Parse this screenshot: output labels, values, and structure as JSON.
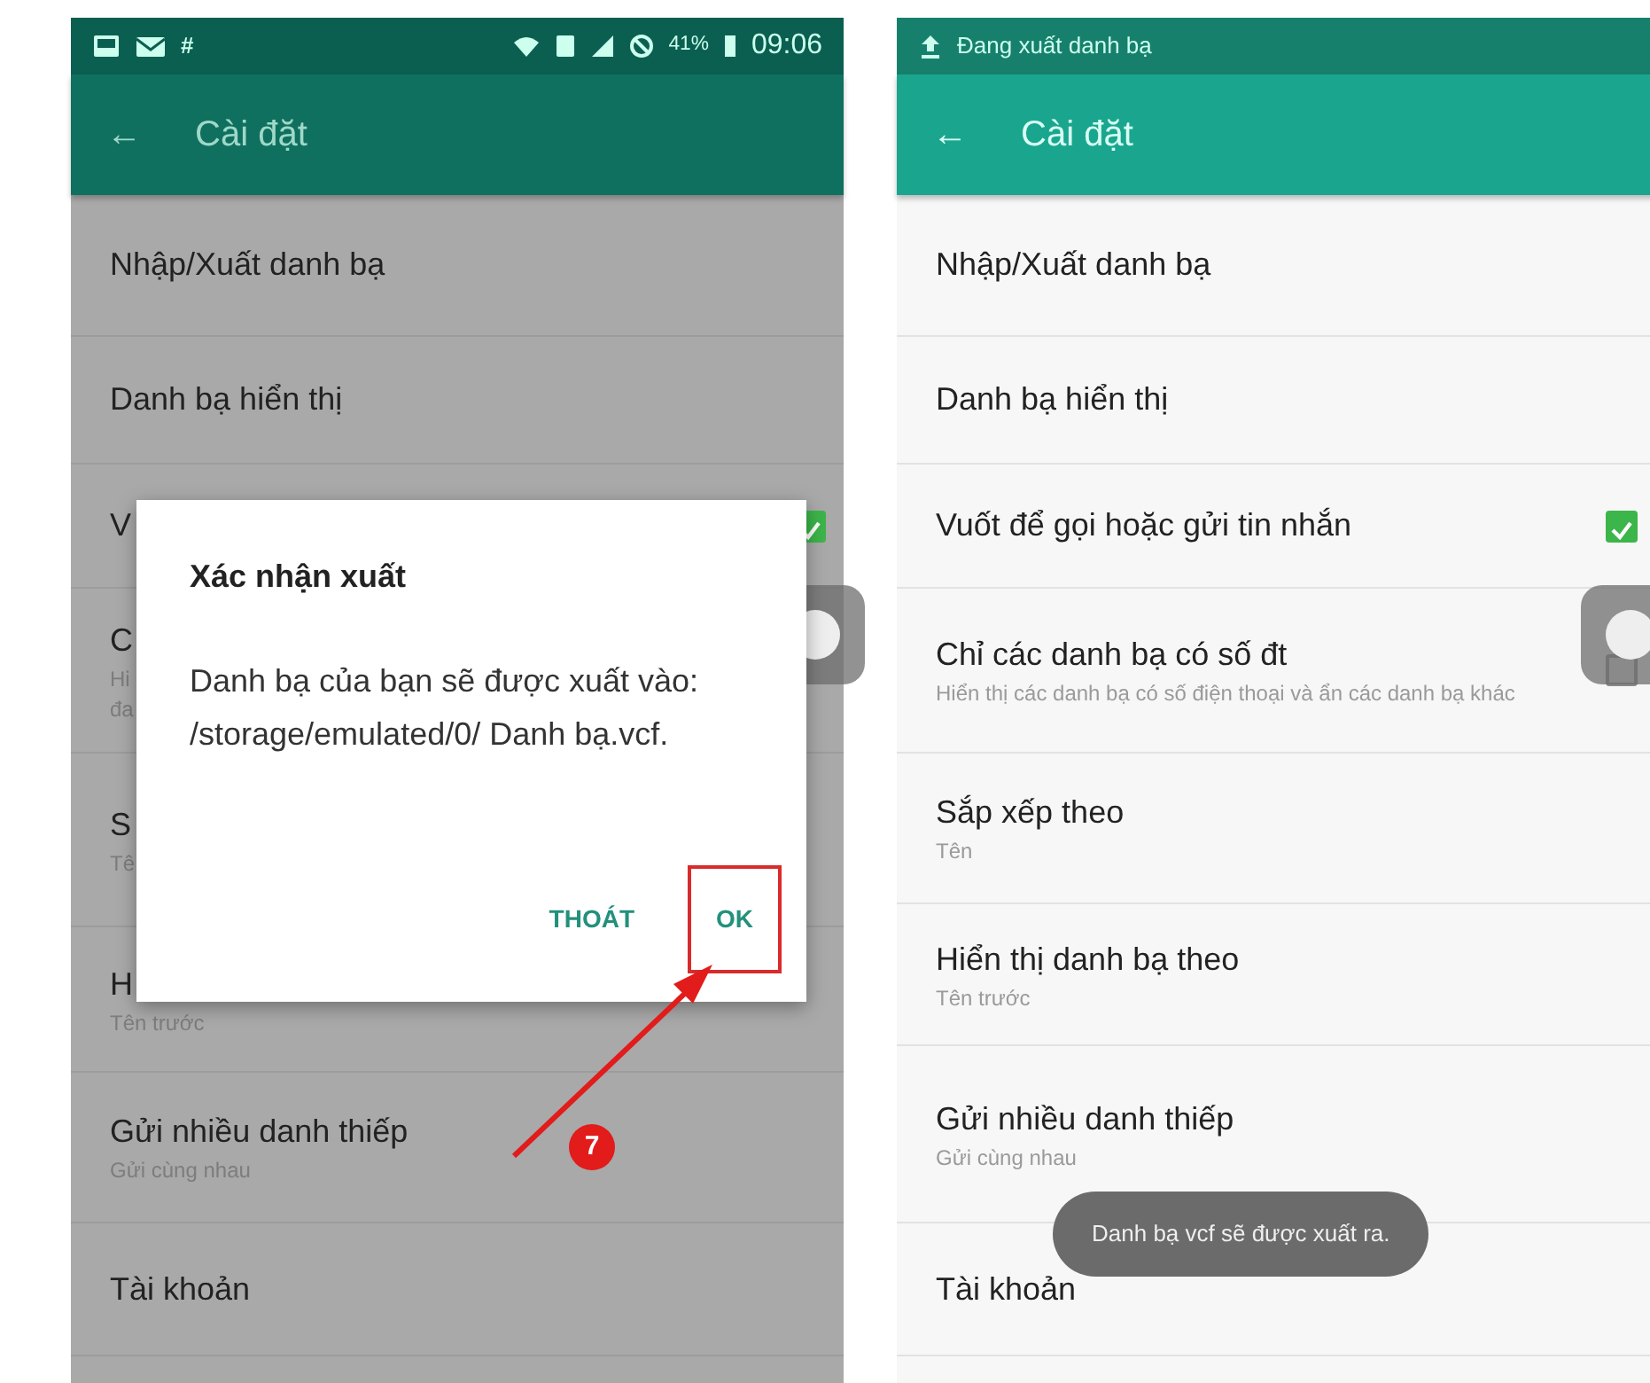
{
  "phones": [
    {
      "dimmed": true,
      "status_bar": {
        "left_text": "#",
        "time": "09:06",
        "battery": "41%"
      },
      "app_bar": {
        "back": "←",
        "title": "Cài đặt"
      },
      "rows": [
        {
          "title": "Nhập/Xuất danh bạ"
        },
        {
          "title": "Danh bạ hiển thị"
        },
        {
          "title": "V",
          "checked": true
        },
        {
          "title": "C",
          "subtitle": "Hi\nđa"
        },
        {
          "title": "S",
          "subtitle": "Tê"
        },
        {
          "title": "H",
          "subtitle": "Tên trước"
        },
        {
          "title": "Gửi nhiều danh thiếp",
          "subtitle": "Gửi cùng nhau"
        },
        {
          "title": "Tài khoản"
        }
      ],
      "dialog": {
        "title": "Xác nhận xuất",
        "message": "Danh bạ của bạn sẽ được xuất vào: /storage/emulated/0/ Danh bạ.vcf.",
        "buttons": [
          {
            "label": "THOÁT",
            "highlighted": false
          },
          {
            "label": "OK",
            "highlighted": true
          }
        ]
      },
      "step_badge": "7"
    },
    {
      "dimmed": false,
      "status_bar": {
        "notification": "Đang xuất danh bạ"
      },
      "app_bar": {
        "back": "←",
        "title": "Cài đặt"
      },
      "rows": [
        {
          "title": "Nhập/Xuất danh bạ"
        },
        {
          "title": "Danh bạ hiển thị"
        },
        {
          "title": "Vuốt để gọi hoặc gửi tin nhắn",
          "checked": true
        },
        {
          "title": "Chỉ các danh bạ có số đt",
          "subtitle": "Hiển thị các danh bạ có số điện thoại và ẩn các danh bạ khác",
          "checked": false
        },
        {
          "title": "Sắp xếp theo",
          "subtitle": "Tên"
        },
        {
          "title": "Hiển thị danh bạ theo",
          "subtitle": "Tên trước"
        },
        {
          "title": "Gửi nhiều danh thiếp",
          "subtitle": "Gửi cùng nhau"
        },
        {
          "title": "Tài khoản"
        }
      ],
      "toast": "Danh bạ vcf sẽ được xuất ra."
    }
  ]
}
